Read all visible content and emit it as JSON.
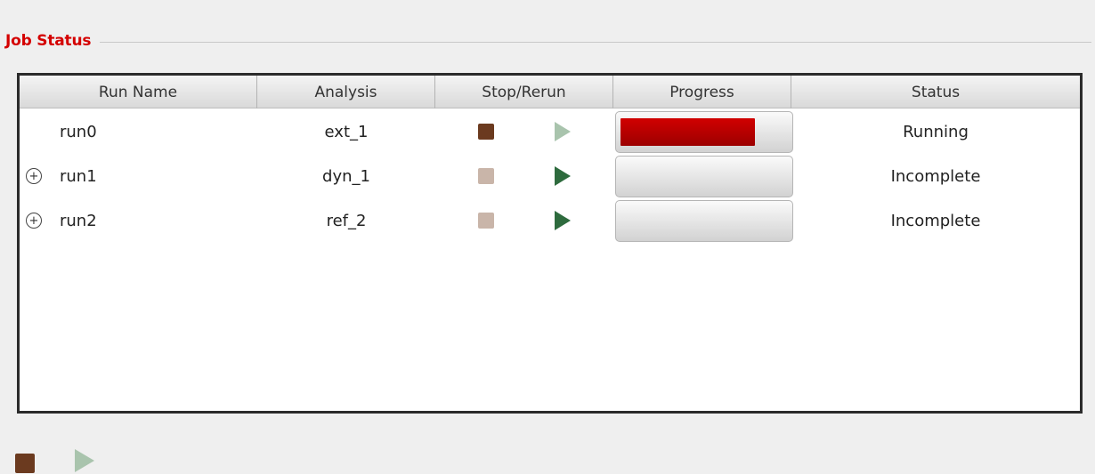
{
  "panel": {
    "title": "Job Status"
  },
  "table": {
    "columns": [
      "Run Name",
      "Analysis",
      "Stop/Rerun",
      "Progress",
      "Status"
    ],
    "rows": [
      {
        "expandable": false,
        "run_name": "run0",
        "analysis": "ext_1",
        "stop_enabled": true,
        "rerun_enabled": false,
        "progress": 0.8,
        "status": "Running"
      },
      {
        "expandable": true,
        "run_name": "run1",
        "analysis": "dyn_1",
        "stop_enabled": false,
        "rerun_enabled": true,
        "progress": 0,
        "status": "Incomplete"
      },
      {
        "expandable": true,
        "run_name": "run2",
        "analysis": "ref_2",
        "stop_enabled": false,
        "rerun_enabled": true,
        "progress": 0,
        "status": "Incomplete"
      }
    ]
  },
  "footer": {
    "stop_all_enabled": true,
    "rerun_all_enabled": false
  },
  "colors": {
    "title": "#d40000",
    "stop_active": "#6b3a1f",
    "stop_disabled": "#c9b5a9",
    "play_active": "#2e6b3e",
    "play_disabled": "#a9c4ad",
    "progress_fill": "#c00000"
  },
  "icons": {
    "stop": "square-stop-icon",
    "rerun": "play-triangle-icon",
    "expand": "circle-plus-icon"
  }
}
